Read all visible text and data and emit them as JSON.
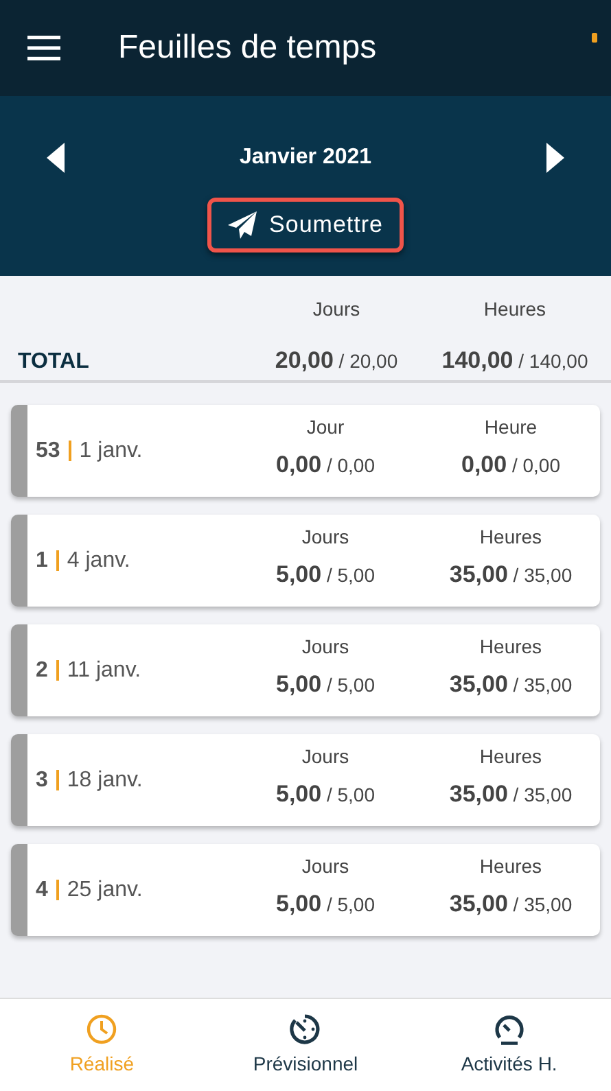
{
  "app_bar": {
    "title": "Feuilles de temps"
  },
  "period": {
    "label": "Janvier 2021",
    "submit": "Soumettre"
  },
  "total": {
    "label": "TOTAL",
    "columns": [
      {
        "heading": "Jours",
        "value": "20,00",
        "target": "/ 20,00"
      },
      {
        "heading": "Heures",
        "value": "140,00",
        "target": "/ 140,00"
      }
    ]
  },
  "weeks": [
    {
      "week": "53",
      "date": "1 janv.",
      "columns": [
        {
          "heading": "Jour",
          "value": "0,00",
          "target": "/ 0,00"
        },
        {
          "heading": "Heure",
          "value": "0,00",
          "target": "/ 0,00"
        }
      ]
    },
    {
      "week": "1",
      "date": "4 janv.",
      "columns": [
        {
          "heading": "Jours",
          "value": "5,00",
          "target": "/ 5,00"
        },
        {
          "heading": "Heures",
          "value": "35,00",
          "target": "/ 35,00"
        }
      ]
    },
    {
      "week": "2",
      "date": "11 janv.",
      "columns": [
        {
          "heading": "Jours",
          "value": "5,00",
          "target": "/ 5,00"
        },
        {
          "heading": "Heures",
          "value": "35,00",
          "target": "/ 35,00"
        }
      ]
    },
    {
      "week": "3",
      "date": "18 janv.",
      "columns": [
        {
          "heading": "Jours",
          "value": "5,00",
          "target": "/ 5,00"
        },
        {
          "heading": "Heures",
          "value": "35,00",
          "target": "/ 35,00"
        }
      ]
    },
    {
      "week": "4",
      "date": "25 janv.",
      "columns": [
        {
          "heading": "Jours",
          "value": "5,00",
          "target": "/ 5,00"
        },
        {
          "heading": "Heures",
          "value": "35,00",
          "target": "/ 35,00"
        }
      ]
    }
  ],
  "tabs": [
    {
      "label": "Réalisé",
      "kind": "clock",
      "selected": true
    },
    {
      "label": "Prévisionnel",
      "kind": "timer",
      "selected": false
    },
    {
      "label": "Activités H.",
      "kind": "gauge",
      "selected": false
    }
  ]
}
